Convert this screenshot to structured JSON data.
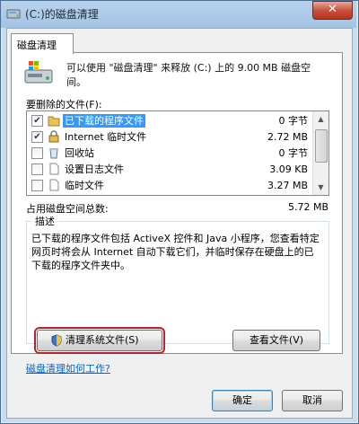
{
  "window": {
    "title": "(C:)的磁盘清理",
    "close_label": "✕"
  },
  "tab": {
    "label": "磁盘清理"
  },
  "intro": {
    "text": "可以使用 \"磁盘清理\" 来释放 (C:) 上的 9.00 MB 磁盘空间。"
  },
  "files": {
    "label": "要删除的文件(F):",
    "rows": [
      {
        "name": "已下载的程序文件",
        "size": "0 字节",
        "checked": "✔",
        "icon": "folder-icon"
      },
      {
        "name": "Internet 临时文件",
        "size": "2.72 MB",
        "checked": "✔",
        "icon": "lock-icon"
      },
      {
        "name": "回收站",
        "size": "0 字节",
        "checked": "",
        "icon": "recycle-bin-icon"
      },
      {
        "name": "设置日志文件",
        "size": "3.09 KB",
        "checked": "",
        "icon": "file-icon"
      },
      {
        "name": "临时文件",
        "size": "3.27 MB",
        "checked": "",
        "icon": "file-icon"
      }
    ],
    "selected_index": 0
  },
  "total": {
    "label": "占用磁盘空间总数:",
    "value": "5.72 MB"
  },
  "description": {
    "title": "描述",
    "text": "已下载的程序文件包括 ActiveX 控件和 Java 小程序，您查看特定网页时将会从 Internet 自动下载它们，并临时保存在硬盘上的已下载的程序文件夹中。"
  },
  "buttons": {
    "clean_system": "清理系统文件(S)",
    "view_files": "查看文件(V)",
    "ok": "确定",
    "cancel": "取消"
  },
  "link": {
    "how_it_works": "磁盘清理如何工作?"
  },
  "colors": {
    "highlight": "#3399ff",
    "callout_border": "#c0202a",
    "link": "#0066cc"
  }
}
